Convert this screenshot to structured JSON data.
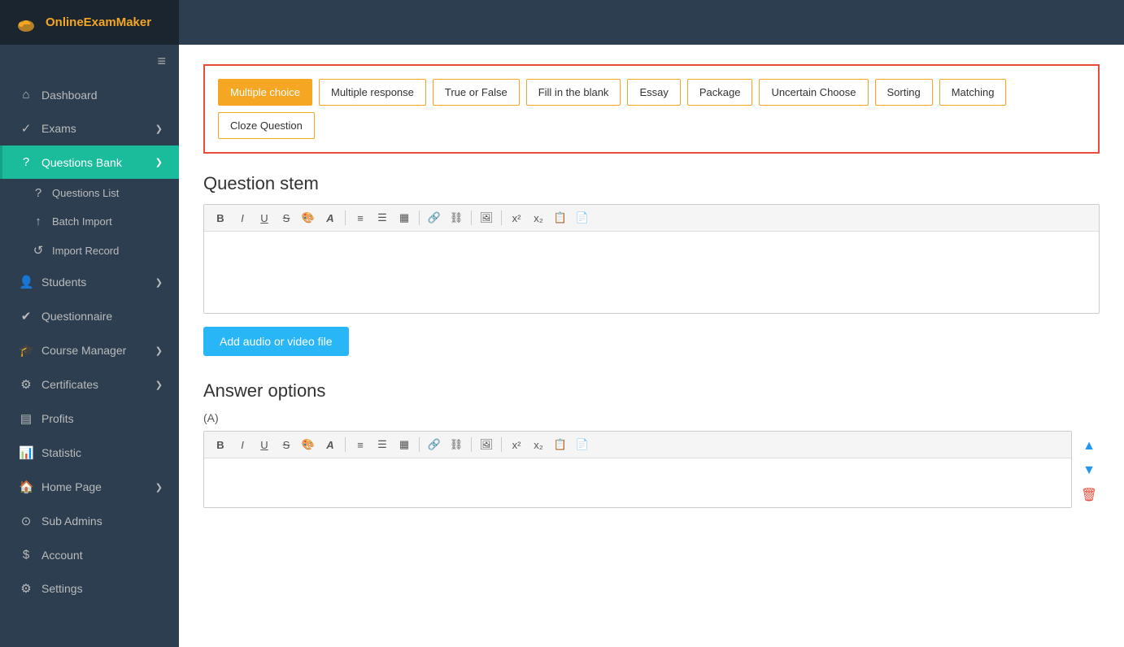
{
  "brand": {
    "name": "OnlineExamMaker"
  },
  "sidebar": {
    "toggle_icon": "≡",
    "items": [
      {
        "id": "dashboard",
        "label": "Dashboard",
        "icon": "⌂",
        "active": false
      },
      {
        "id": "exams",
        "label": "Exams",
        "icon": "✓",
        "active": false,
        "has_chevron": true
      },
      {
        "id": "questions-bank",
        "label": "Questions Bank",
        "icon": "?",
        "active": true,
        "has_chevron": true
      },
      {
        "id": "questions-list",
        "label": "Questions List",
        "icon": "",
        "sub": true
      },
      {
        "id": "batch-import",
        "label": "Batch Import",
        "icon": "",
        "sub": true
      },
      {
        "id": "import-record",
        "label": "Import Record",
        "icon": "",
        "sub": true
      },
      {
        "id": "students",
        "label": "Students",
        "icon": "👤",
        "active": false,
        "has_chevron": true
      },
      {
        "id": "questionnaire",
        "label": "Questionnaire",
        "icon": "✔",
        "active": false
      },
      {
        "id": "course-manager",
        "label": "Course Manager",
        "icon": "🎓",
        "active": false,
        "has_chevron": true
      },
      {
        "id": "certificates",
        "label": "Certificates",
        "icon": "⚙",
        "active": false,
        "has_chevron": true
      },
      {
        "id": "profits",
        "label": "Profits",
        "icon": "▤",
        "active": false
      },
      {
        "id": "statistic",
        "label": "Statistic",
        "icon": "📊",
        "active": false
      },
      {
        "id": "homepage",
        "label": "Home Page",
        "icon": "🏠",
        "active": false,
        "has_chevron": true
      },
      {
        "id": "sub-admins",
        "label": "Sub Admins",
        "icon": "⊙",
        "active": false
      },
      {
        "id": "account",
        "label": "Account",
        "icon": "$",
        "active": false
      },
      {
        "id": "settings",
        "label": "Settings",
        "icon": "⚙",
        "active": false
      }
    ]
  },
  "question_types": {
    "items": [
      {
        "id": "multiple-choice",
        "label": "Multiple choice",
        "active": true
      },
      {
        "id": "multiple-response",
        "label": "Multiple response",
        "active": false
      },
      {
        "id": "true-or-false",
        "label": "True or False",
        "active": false
      },
      {
        "id": "fill-in-blank",
        "label": "Fill in the blank",
        "active": false
      },
      {
        "id": "essay",
        "label": "Essay",
        "active": false
      },
      {
        "id": "package",
        "label": "Package",
        "active": false
      },
      {
        "id": "uncertain-choose",
        "label": "Uncertain Choose",
        "active": false
      },
      {
        "id": "sorting",
        "label": "Sorting",
        "active": false
      },
      {
        "id": "matching",
        "label": "Matching",
        "active": false
      },
      {
        "id": "cloze-question",
        "label": "Cloze Question",
        "active": false
      }
    ]
  },
  "question_stem": {
    "title": "Question stem",
    "toolbar": [
      "B",
      "I",
      "U",
      "S",
      "🎨",
      "A",
      "|",
      "≡",
      "☰",
      "▦",
      "|",
      "🔗",
      "🔗",
      "|",
      "🖼",
      "|",
      "x²",
      "x₂",
      "📋",
      "📄"
    ]
  },
  "add_media": {
    "label": "Add audio or video file"
  },
  "answer_options": {
    "title": "Answer options",
    "label": "(A)",
    "toolbar": [
      "B",
      "I",
      "U",
      "S",
      "🎨",
      "A",
      "|",
      "≡",
      "☰",
      "▦",
      "|",
      "🔗",
      "🔗",
      "|",
      "🖼",
      "|",
      "x²",
      "x₂",
      "📋",
      "📄"
    ]
  },
  "colors": {
    "brand_orange": "#f5a623",
    "active_green": "#1abc9c",
    "sidebar_bg": "#2c3e50",
    "add_media_blue": "#29b6f6",
    "red_border": "#e74c3c"
  }
}
